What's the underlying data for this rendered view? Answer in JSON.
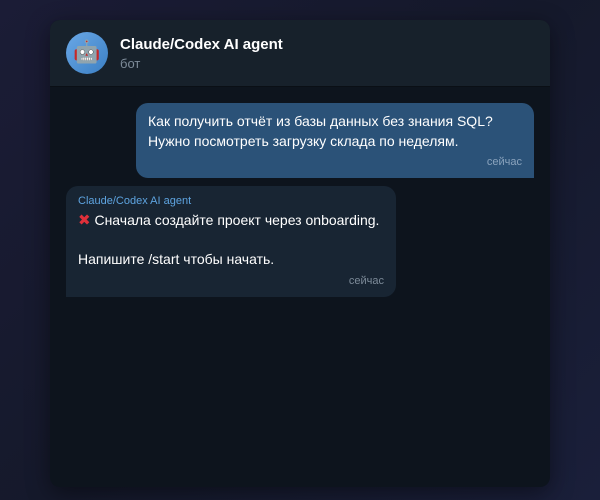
{
  "header": {
    "title": "Claude/Codex AI agent",
    "subtitle": "бот",
    "avatar_icon": "robot-icon",
    "avatar_glyph": "🤖"
  },
  "messages": [
    {
      "direction": "outgoing",
      "lines": [
        "Как получить отчёт из базы данных без знания SQL?",
        "Нужно посмотреть загрузку склада по неделям."
      ],
      "time": "сейчас"
    },
    {
      "direction": "incoming",
      "sender": "Claude/Codex AI agent",
      "status_icon": "cross-mark-icon",
      "status_glyph": "✖",
      "line1": "Сначала создайте проект через onboarding.",
      "line2": "Напишите /start чтобы начать.",
      "time": "сейчас"
    }
  ],
  "colors": {
    "outgoing_bubble": "#2b5278",
    "incoming_bubble": "#182533",
    "sender_name": "#5ea4e0",
    "error_cross": "#e0303a"
  }
}
